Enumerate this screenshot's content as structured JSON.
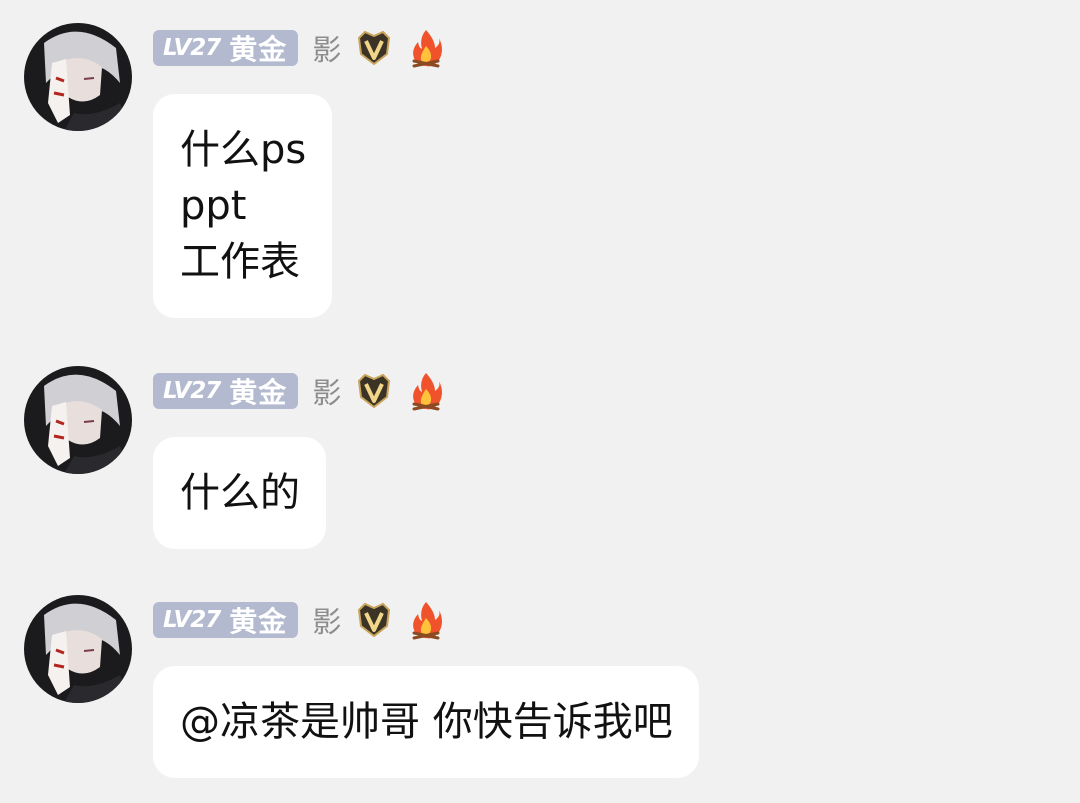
{
  "messages": [
    {
      "user": {
        "level": "LV27",
        "tier": "黄金",
        "nickname": "影",
        "vip_icon": "vip-v-crest-icon",
        "fire_icon": "fire-icon"
      },
      "lines": [
        "什么ps",
        "ppt",
        "工作表"
      ]
    },
    {
      "user": {
        "level": "LV27",
        "tier": "黄金",
        "nickname": "影",
        "vip_icon": "vip-v-crest-icon",
        "fire_icon": "fire-icon"
      },
      "lines": [
        "什么的"
      ]
    },
    {
      "user": {
        "level": "LV27",
        "tier": "黄金",
        "nickname": "影",
        "vip_icon": "vip-v-crest-icon",
        "fire_icon": "fire-icon"
      },
      "lines": [
        "@凉茶是帅哥 你快告诉我吧"
      ]
    }
  ],
  "colors": {
    "background": "#f1f1f1",
    "bubble": "#ffffff",
    "level_badge": "#b3b9cf",
    "nickname": "#8d8d8d"
  }
}
